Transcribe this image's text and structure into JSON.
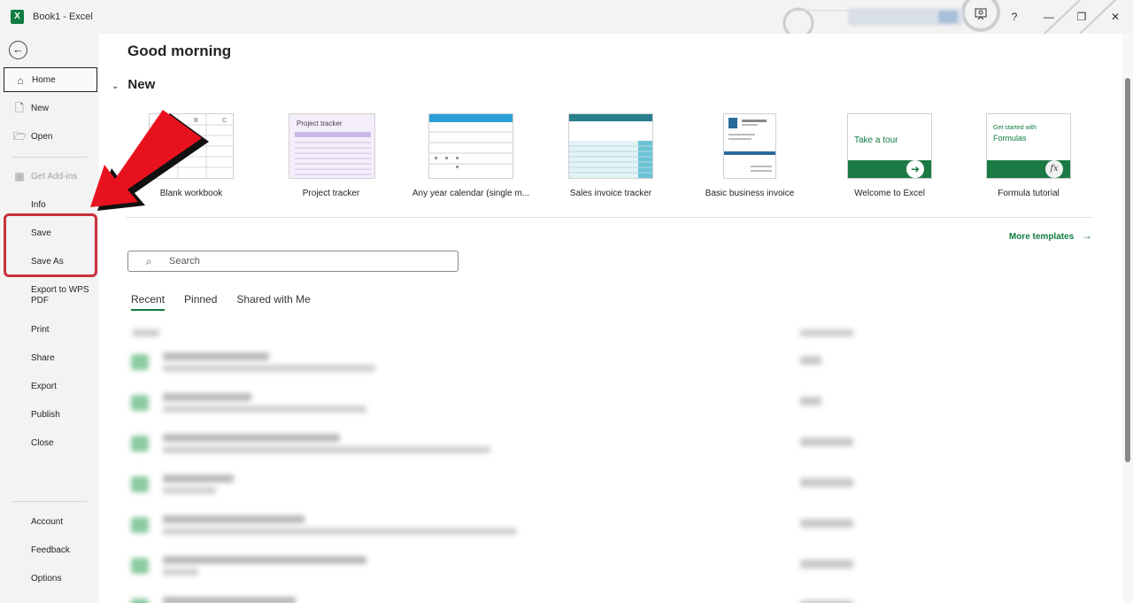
{
  "window": {
    "title": "Book1 - Excel",
    "app_icon_letter": "X"
  },
  "titlebar": {
    "help_label": "?",
    "minimize_label": "—",
    "restore_label": "❐",
    "close_label": "✕"
  },
  "sidebar": {
    "back_icon": "back-arrow-icon",
    "items": [
      {
        "label": "Home"
      },
      {
        "label": "New"
      },
      {
        "label": "Open"
      },
      {
        "label": "Get Add-ins"
      },
      {
        "label": "Info"
      },
      {
        "label": "Save"
      },
      {
        "label": "Save As"
      },
      {
        "label": "Export to WPS PDF"
      },
      {
        "label": "Print"
      },
      {
        "label": "Share"
      },
      {
        "label": "Export"
      },
      {
        "label": "Publish"
      },
      {
        "label": "Close"
      }
    ],
    "bottom_items": [
      {
        "label": "Account"
      },
      {
        "label": "Feedback"
      },
      {
        "label": "Options"
      }
    ]
  },
  "main": {
    "greeting": "Good morning",
    "new_section_title": "New",
    "templates": [
      {
        "label": "Blank workbook",
        "thumb_text": ""
      },
      {
        "label": "Project tracker",
        "thumb_text": "Project tracker"
      },
      {
        "label": "Any year calendar (single m...",
        "thumb_text": ""
      },
      {
        "label": "Sales invoice tracker",
        "thumb_text": ""
      },
      {
        "label": "Basic business invoice",
        "thumb_text": ""
      },
      {
        "label": "Welcome to Excel",
        "thumb_text": "Take a tour"
      },
      {
        "label": "Formula tutorial",
        "thumb_text": "Get started with",
        "thumb_text2": "Formulas"
      }
    ],
    "more_templates": "More templates",
    "search": {
      "placeholder": "Search"
    },
    "tabs": [
      {
        "label": "Recent"
      },
      {
        "label": "Pinned"
      },
      {
        "label": "Shared with Me"
      }
    ]
  },
  "colors": {
    "accent": "#107c41",
    "highlight": "#c8323c",
    "arrow": "#e8121e"
  }
}
